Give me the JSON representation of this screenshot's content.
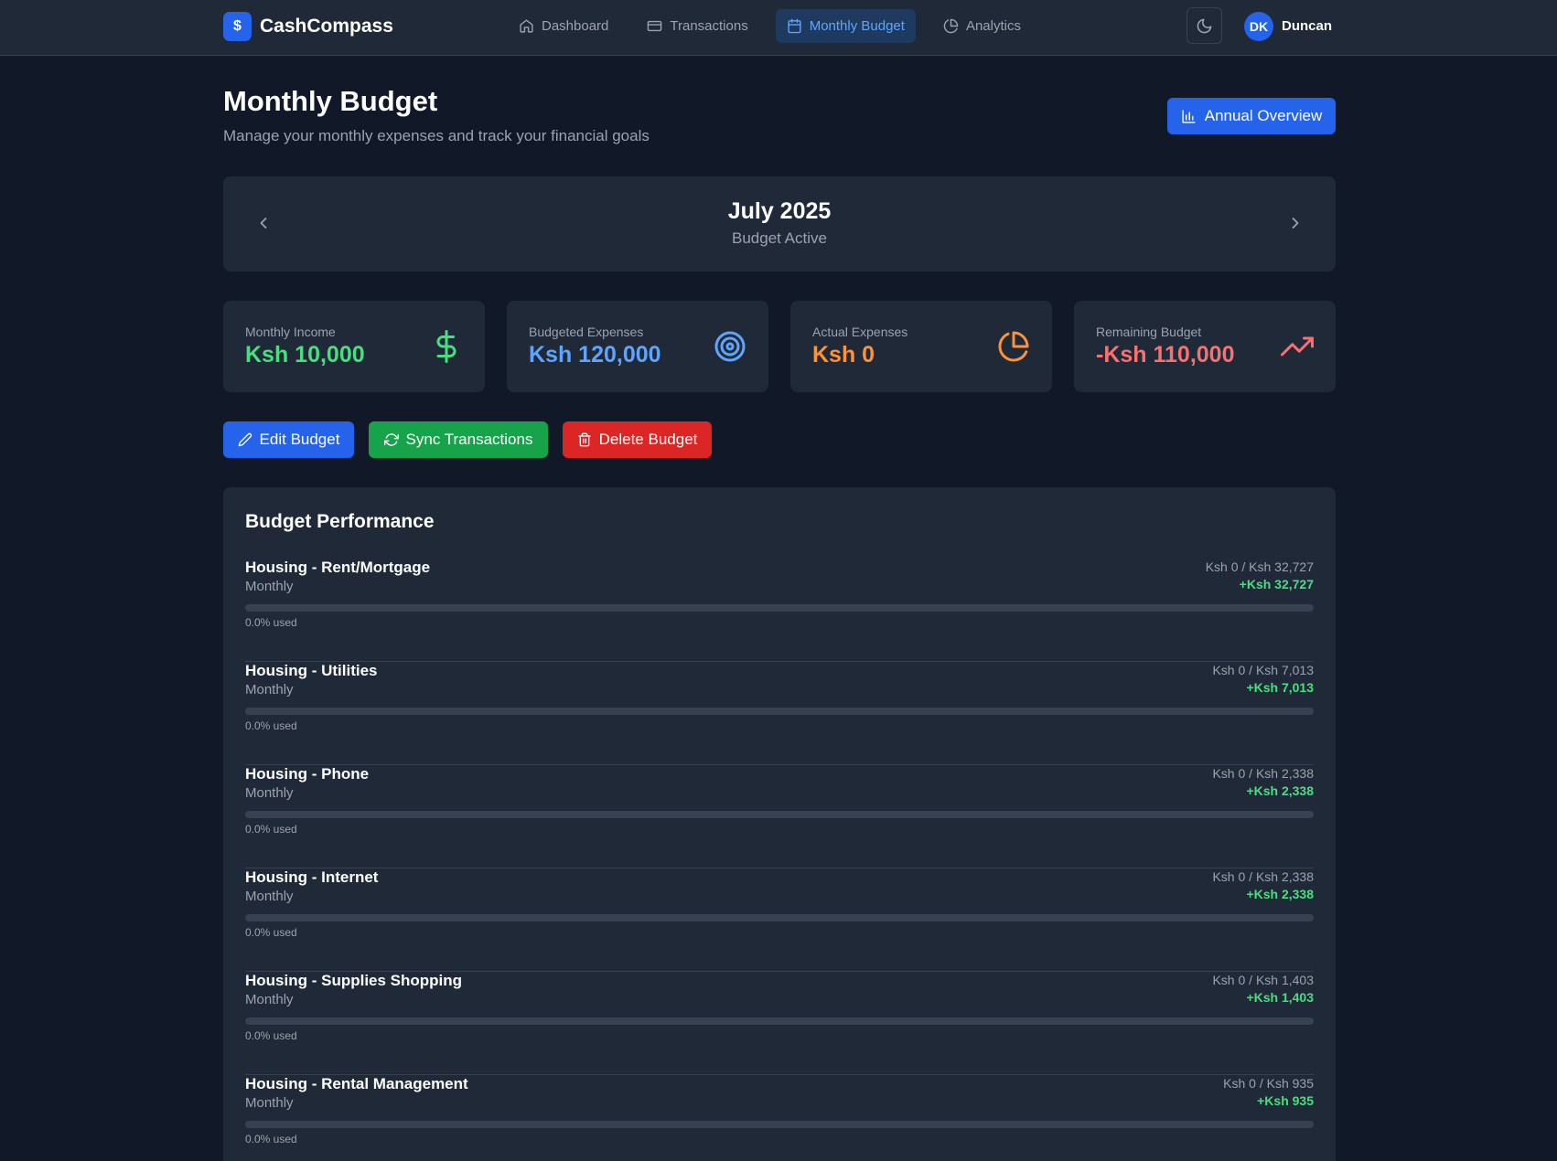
{
  "nav": {
    "brand_logo": "$",
    "brand_name": "CashCompass",
    "links": [
      {
        "label": "Dashboard",
        "icon": "home-icon",
        "active": false
      },
      {
        "label": "Transactions",
        "icon": "credit-card-icon",
        "active": false
      },
      {
        "label": "Monthly Budget",
        "icon": "calendar-icon",
        "active": true
      },
      {
        "label": "Analytics",
        "icon": "pie-chart-icon",
        "active": false
      }
    ],
    "theme_icon": "moon-icon",
    "user_initials": "DK",
    "user_name": "Duncan"
  },
  "header": {
    "title": "Monthly Budget",
    "subtitle": "Manage your monthly expenses and track your financial goals",
    "annual_button": "Annual Overview"
  },
  "month": {
    "title": "July 2025",
    "status": "Budget Active"
  },
  "stats": [
    {
      "label": "Monthly Income",
      "value": "Ksh 10,000",
      "color": "#4ade80",
      "icon": "dollar-icon"
    },
    {
      "label": "Budgeted Expenses",
      "value": "Ksh 120,000",
      "color": "#60a5fa",
      "icon": "target-icon"
    },
    {
      "label": "Actual Expenses",
      "value": "Ksh 0",
      "color": "#fb923c",
      "icon": "pie-chart-icon"
    },
    {
      "label": "Remaining Budget",
      "value": "-Ksh 110,000",
      "color": "#f87171",
      "icon": "trending-up-icon"
    }
  ],
  "actions": {
    "edit": "Edit Budget",
    "sync": "Sync Transactions",
    "delete": "Delete Budget"
  },
  "performance": {
    "title": "Budget Performance",
    "rows": [
      {
        "name": "Housing - Rent/Mortgage",
        "period": "Monthly",
        "amounts": "Ksh 0 / Ksh 32,727",
        "remaining": "+Ksh 32,727",
        "used": "0.0% used",
        "used_fraction": 0
      },
      {
        "name": "Housing - Utilities",
        "period": "Monthly",
        "amounts": "Ksh 0 / Ksh 7,013",
        "remaining": "+Ksh 7,013",
        "used": "0.0% used",
        "used_fraction": 0
      },
      {
        "name": "Housing - Phone",
        "period": "Monthly",
        "amounts": "Ksh 0 / Ksh 2,338",
        "remaining": "+Ksh 2,338",
        "used": "0.0% used",
        "used_fraction": 0
      },
      {
        "name": "Housing - Internet",
        "period": "Monthly",
        "amounts": "Ksh 0 / Ksh 2,338",
        "remaining": "+Ksh 2,338",
        "used": "0.0% used",
        "used_fraction": 0
      },
      {
        "name": "Housing - Supplies Shopping",
        "period": "Monthly",
        "amounts": "Ksh 0 / Ksh 1,403",
        "remaining": "+Ksh 1,403",
        "used": "0.0% used",
        "used_fraction": 0
      },
      {
        "name": "Housing - Rental Management",
        "period": "Monthly",
        "amounts": "Ksh 0 / Ksh 935",
        "remaining": "+Ksh 935",
        "used": "0.0% used",
        "used_fraction": 0
      }
    ]
  }
}
